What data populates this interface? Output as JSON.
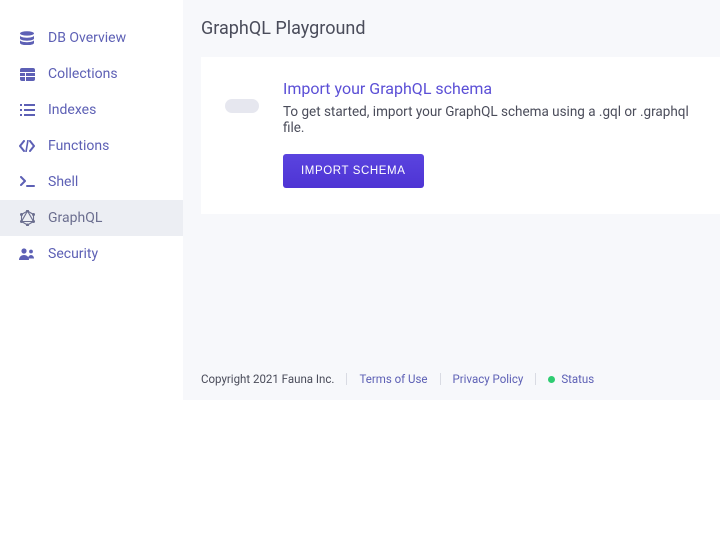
{
  "sidebar": {
    "items": [
      {
        "label": "DB Overview"
      },
      {
        "label": "Collections"
      },
      {
        "label": "Indexes"
      },
      {
        "label": "Functions"
      },
      {
        "label": "Shell"
      },
      {
        "label": "GraphQL"
      },
      {
        "label": "Security"
      }
    ]
  },
  "main": {
    "title": "GraphQL Playground",
    "card": {
      "title": "Import your GraphQL schema",
      "desc": "To get started, import your GraphQL schema using a .gql or .graphql file.",
      "button": "IMPORT SCHEMA"
    }
  },
  "footer": {
    "copyright": "Copyright 2021 Fauna Inc.",
    "terms": "Terms of Use",
    "privacy": "Privacy Policy",
    "status": "Status"
  },
  "colors": {
    "accent": "#5b3fe0",
    "sidebar_text": "#5d60b5",
    "status_dot": "#2ecc71"
  }
}
